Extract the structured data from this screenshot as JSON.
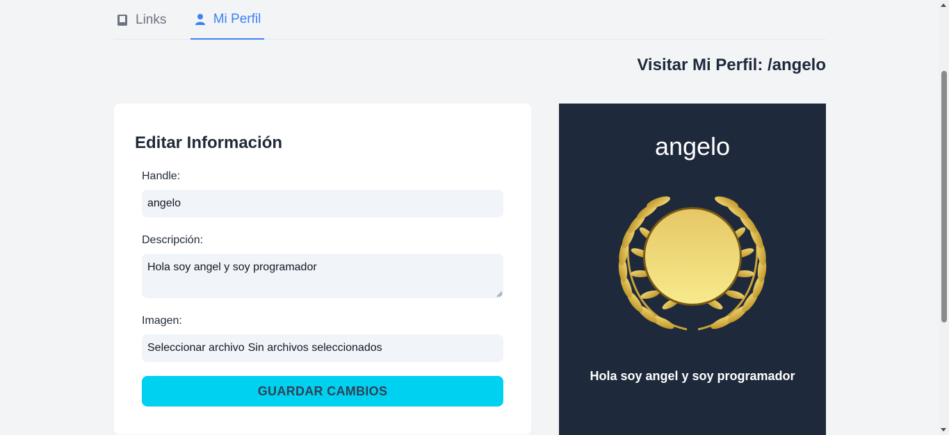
{
  "tabs": [
    {
      "label": "Links",
      "icon": "book-icon",
      "active": false
    },
    {
      "label": "Mi Perfil",
      "icon": "user-icon",
      "active": true
    }
  ],
  "visit_link": "Visitar Mi Perfil: /angelo",
  "form": {
    "title": "Editar Información",
    "handle_label": "Handle:",
    "handle_value": "angelo",
    "description_label": "Descripción:",
    "description_value": "Hola soy angel y soy programador",
    "image_label": "Imagen:",
    "file_button": "Seleccionar archivo",
    "file_status": "Sin archivos seleccionados",
    "save_label": "GUARDAR CAMBIOS"
  },
  "preview": {
    "name": "angelo",
    "description": "Hola soy angel y soy programador",
    "image_icon": "laurel-medal-icon"
  },
  "colors": {
    "accent_blue": "#3b82f6",
    "button_cyan": "#00d1f0",
    "preview_bg": "#1e293b",
    "page_bg": "#f3f4f6"
  }
}
